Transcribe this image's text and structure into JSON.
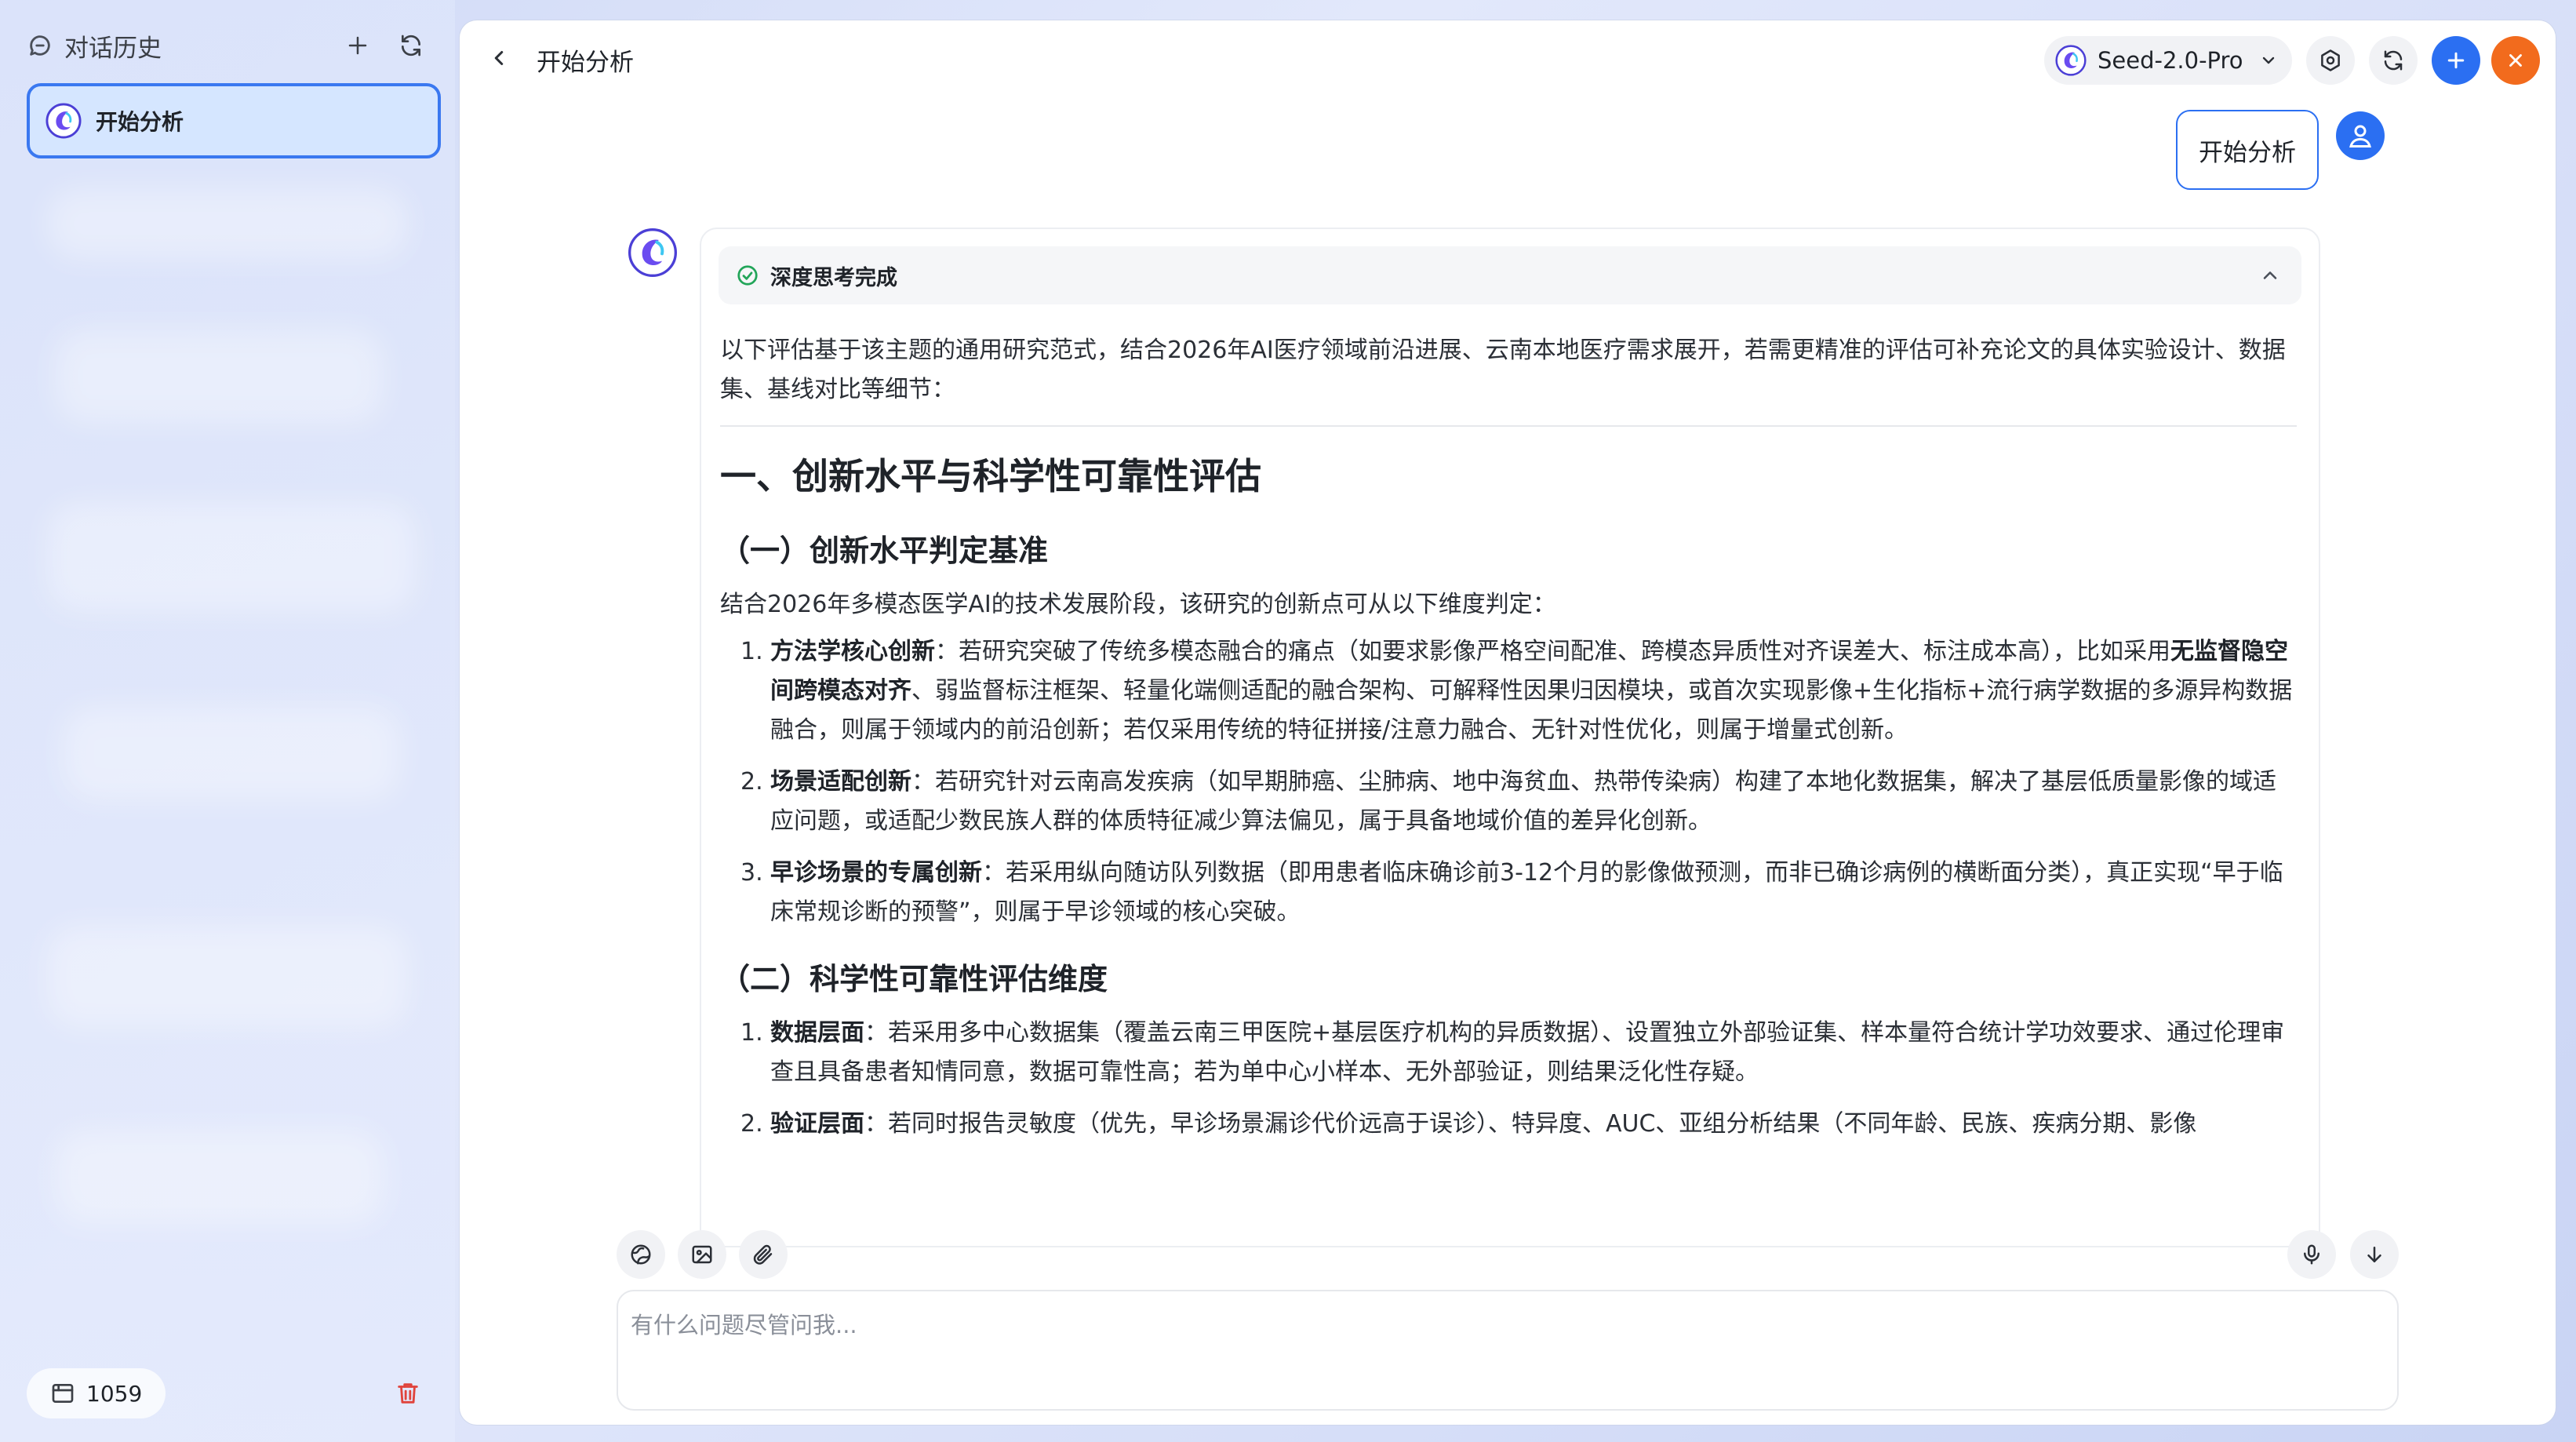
{
  "sidebar": {
    "title": "对话历史",
    "conversations": [
      {
        "label": "开始分析",
        "selected": true
      }
    ],
    "footer_count": "1059"
  },
  "header": {
    "title": "开始分析",
    "model": "Seed-2.0-Pro"
  },
  "user_message": "开始分析",
  "thinking": {
    "status": "深度思考完成"
  },
  "answer": {
    "intro": "以下评估基于该主题的通用研究范式，结合2026年AI医疗领域前沿进展、云南本地医疗需求展开，若需更精准的评估可补充论文的具体实验设计、数据集、基线对比等细节：",
    "h1": "一、创新水平与科学性可靠性评估",
    "section1": {
      "heading": "（一）创新水平判定基准",
      "lead": "结合2026年多模态医学AI的技术发展阶段，该研究的创新点可从以下维度判定：",
      "items": [
        {
          "num": "1.",
          "title": "方法学核心创新",
          "pre": "：若研究突破了传统多模态融合的痛点（如要求影像严格空间配准、跨模态异质性对齐误差大、标注成本高），比如采用",
          "bold2": "无监督隐空间跨模态对齐",
          "post": "、弱监督标注框架、轻量化端侧适配的融合架构、可解释性因果归因模块，或首次实现影像+生化指标+流行病学数据的多源异构数据融合，则属于领域内的前沿创新；若仅采用传统的特征拼接/注意力融合、无针对性优化，则属于增量式创新。"
        },
        {
          "num": "2.",
          "title": "场景适配创新",
          "text": "：若研究针对云南高发疾病（如早期肺癌、尘肺病、地中海贫血、热带传染病）构建了本地化数据集，解决了基层低质量影像的域适应问题，或适配少数民族人群的体质特征减少算法偏见，属于具备地域价值的差异化创新。"
        },
        {
          "num": "3.",
          "title": "早诊场景的专属创新",
          "text": "：若采用纵向随访队列数据（即用患者临床确诊前3-12个月的影像做预测，而非已确诊病例的横断面分类），真正实现“早于临床常规诊断的预警”，则属于早诊领域的核心突破。"
        }
      ]
    },
    "section2": {
      "heading": "（二）科学性可靠性评估维度",
      "items": [
        {
          "num": "1.",
          "title": "数据层面",
          "text": "：若采用多中心数据集（覆盖云南三甲医院+基层医疗机构的异质数据）、设置独立外部验证集、样本量符合统计学功效要求、通过伦理审查且具备患者知情同意，数据可靠性高；若为单中心小样本、无外部验证，则结果泛化性存疑。"
        },
        {
          "num": "2.",
          "title": "验证层面",
          "text": "：若同时报告灵敏度（优先，早诊场景漏诊代价远高于误诊）、特异度、AUC、亚组分析结果（不同年龄、民族、疾病分期、影像"
        }
      ]
    }
  },
  "input": {
    "placeholder": "有什么问题尽管问我..."
  },
  "colors": {
    "accent": "#2b6ff2",
    "close": "#f26b1d",
    "success": "#22a559",
    "danger": "#e0433c"
  },
  "icons": [
    "history-icon",
    "plus-icon",
    "refresh-icon",
    "back-icon",
    "chevron-down-icon",
    "settings-icon",
    "close-icon",
    "user-icon",
    "check-icon",
    "chevron-up-icon",
    "translate-icon",
    "image-icon",
    "attach-icon",
    "mic-icon",
    "arrow-down-icon",
    "archive-icon",
    "trash-icon",
    "app-logo-icon"
  ]
}
